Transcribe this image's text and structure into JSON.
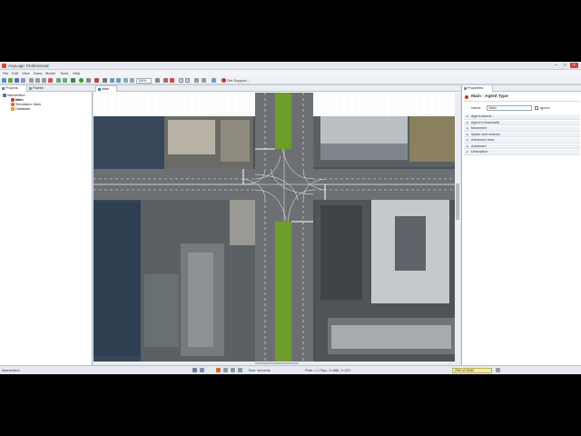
{
  "window": {
    "title": "AnyLogic Professional"
  },
  "menu": [
    "File",
    "Edit",
    "View",
    "Draw",
    "Model",
    "Tools",
    "Help"
  ],
  "toolbar": {
    "zoom": "100%",
    "get_support": "Get Support..."
  },
  "left_panel": {
    "tabs": [
      "Projects",
      "Palette"
    ],
    "tree": [
      {
        "label": "Intersection",
        "indent": 0,
        "icon": "folder-icon"
      },
      {
        "label": "Main",
        "indent": 1,
        "icon": "agent-icon"
      },
      {
        "label": "Simulation: Main",
        "indent": 1,
        "icon": "experiment-icon"
      },
      {
        "label": "Database",
        "indent": 1,
        "icon": "database-icon"
      }
    ]
  },
  "editor": {
    "tab": "Main"
  },
  "properties": {
    "tab": "Properties",
    "header": "Main - Agent Type",
    "name_label": "Name:",
    "name_value": "Main",
    "ignore_label": "Ignore",
    "sections": [
      "Agent actions",
      "Agent in flowcharts",
      "Movement",
      "Space and network",
      "Advanced Java",
      "Advanced",
      "Description"
    ]
  },
  "status": {
    "left": "Intersection",
    "time": "Time: seconds",
    "coords": "Pixel = 0.75px, X=388, Y=127",
    "memory": "29M of 254M"
  },
  "colors": {
    "accent": "#c0392b",
    "grass": "#6f9d2a",
    "road": "#6d7073",
    "water": "#3a4a5c"
  }
}
